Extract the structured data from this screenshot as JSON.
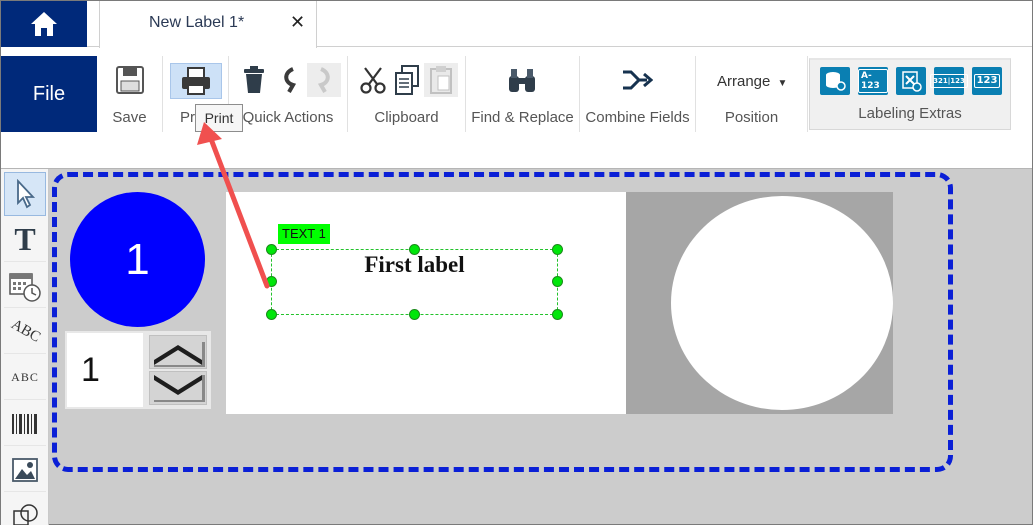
{
  "tabstrip": {
    "home_icon": "home-icon",
    "document_tab": {
      "title": "New Label 1*",
      "close_icon": "close-icon"
    }
  },
  "ribbon": {
    "file_label": "File",
    "groups": {
      "save": {
        "label": "Save",
        "icon": "floppy-disk-icon"
      },
      "print": {
        "label": "Pr",
        "icon": "printer-icon"
      },
      "quick_actions": {
        "label": "Quick Actions",
        "icons": [
          "trash-icon",
          "undo-icon",
          "redo-icon"
        ]
      },
      "clipboard": {
        "label": "Clipboard",
        "icons": [
          "scissors-icon",
          "copy-icon",
          "paste-icon"
        ]
      },
      "find_replace": {
        "label": "Find & Replace",
        "icon": "binoculars-icon"
      },
      "combine_fields": {
        "label": "Combine Fields",
        "icon": "merge-arrow-icon"
      },
      "position": {
        "label": "Position",
        "arrange_label": "Arrange"
      },
      "labeling_extras": {
        "label": "Labeling Extras",
        "icons": [
          {
            "name": "database-icon",
            "text": ""
          },
          {
            "name": "serial-field-icon",
            "text": "A-123"
          },
          {
            "name": "excel-data-icon",
            "text": ""
          },
          {
            "name": "counter-field-icon",
            "text": "321|123"
          },
          {
            "name": "number-field-icon",
            "text": "123"
          }
        ]
      }
    },
    "tooltip": "Print"
  },
  "toolbox": [
    "pointer-tool-icon",
    "text-tool-icon",
    "date-time-tool-icon",
    "curved-text-tool-icon",
    "vertical-text-tool-icon",
    "barcode-tool-icon",
    "image-tool-icon",
    "shape-tool-icon"
  ],
  "label_nav": {
    "number": "1",
    "stepper_value": "1"
  },
  "canvas": {
    "text_object_tag": "TEXT 1",
    "text_object_content": "First label"
  },
  "colors": {
    "brand_blue": "#00297a",
    "label_circle": "#0000ff",
    "selection_green": "#00ff00",
    "frame_blue": "#0a1fd6",
    "annotation_arrow": "#f0504f"
  }
}
